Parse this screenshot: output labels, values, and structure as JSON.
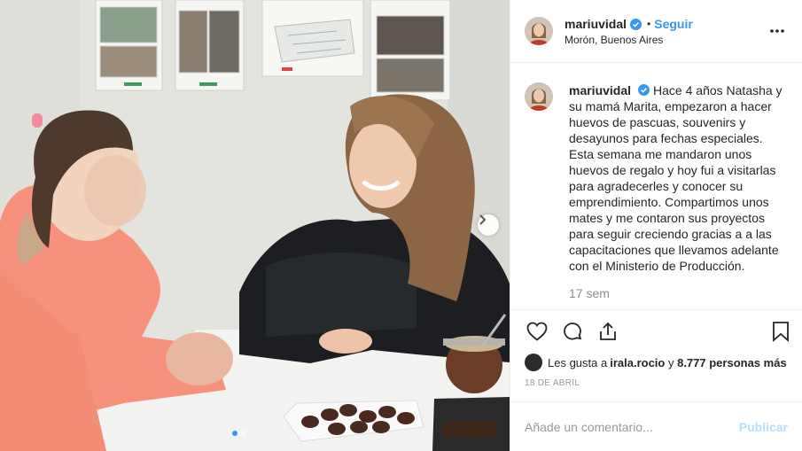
{
  "post": {
    "author": {
      "username": "mariuvidal",
      "verified": true,
      "location": "Morón, Buenos Aires"
    },
    "follow_label": "Seguir",
    "separator": "•",
    "caption": "Hace 4 años Natasha y su mamá Marita, empezaron a hacer huevos de pascuas, souvenirs y desayunos para fechas especiales. Esta semana me mandaron unos huevos de regalo y hoy fui a visitarlas para agradecerles y conocer su emprendimiento. Compartimos unos mates y me contaron sus proyectos para seguir creciendo gracias a a las capacitaciones que llevamos adelante con el Ministerio de Producción.",
    "time_ago": "17 sem",
    "likes": {
      "prefix": "Les gusta a ",
      "first_user": "irala.rocio",
      "middle": " y ",
      "others": "8.777 personas más"
    },
    "date": "18 DE ABRIL",
    "comment_placeholder": "Añade un comentario...",
    "publish_label": "Publicar",
    "carousel": {
      "slide_count": 2,
      "current_index": 0
    }
  },
  "icons": {
    "more": "more-options-icon",
    "like": "heart-icon",
    "comment": "comment-bubble-icon",
    "share": "share-icon",
    "save": "bookmark-icon",
    "next": "chevron-right-icon",
    "verified": "verified-badge-icon"
  },
  "colors": {
    "accent": "#3897f0",
    "publish_disabled": "#b2dffc",
    "muted": "#8e8e8e",
    "text": "#262626"
  }
}
